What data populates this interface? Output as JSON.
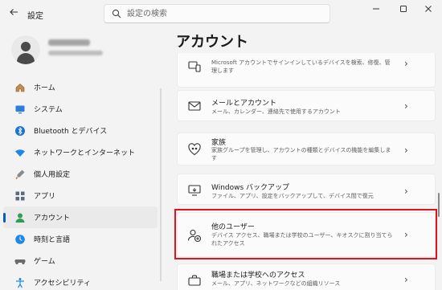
{
  "titlebar": {
    "app_title": "設定",
    "search_placeholder": "設定の検索"
  },
  "nav": {
    "items": [
      {
        "label": "ホーム",
        "icon": "home-icon"
      },
      {
        "label": "システム",
        "icon": "system-icon"
      },
      {
        "label": "Bluetooth とデバイス",
        "icon": "bluetooth-icon"
      },
      {
        "label": "ネットワークとインターネット",
        "icon": "network-icon"
      },
      {
        "label": "個人用設定",
        "icon": "personalization-icon"
      },
      {
        "label": "アプリ",
        "icon": "apps-icon"
      },
      {
        "label": "アカウント",
        "icon": "account-icon",
        "active": true
      },
      {
        "label": "時刻と言語",
        "icon": "time-language-icon"
      },
      {
        "label": "ゲーム",
        "icon": "gaming-icon"
      },
      {
        "label": "アクセシビリティ",
        "icon": "accessibility-icon"
      }
    ]
  },
  "main": {
    "page_title": "アカウント",
    "cards": [
      {
        "title": "",
        "desc": "Microsoft アカウントでサインインしているデバイスを検索、修復、管理します",
        "icon": "devices-icon"
      },
      {
        "title": "メールとアカウント",
        "desc": "メール、カレンダー、連絡先で使用するアカウント",
        "icon": "mail-icon"
      },
      {
        "title": "家族",
        "desc": "家族グループを管理し、アカウントの種類とデバイスの機能を編集します",
        "icon": "family-icon"
      },
      {
        "title": "Windows バックアップ",
        "desc": "ファイル、アプリ、設定をバックアップして、デバイス間で復元",
        "icon": "backup-icon"
      },
      {
        "title": "他のユーザー",
        "desc": "デバイス アクセス、職場または学校のユーザー、キオスクに割り当てられたアクセス",
        "icon": "other-users-icon"
      },
      {
        "title": "職場または学校へのアクセス",
        "desc": "メール、アプリ、ネットワークなどの組織リソース",
        "icon": "work-school-icon"
      }
    ]
  },
  "colors": {
    "accent": "#005fb8",
    "highlight": "#e0141e"
  }
}
